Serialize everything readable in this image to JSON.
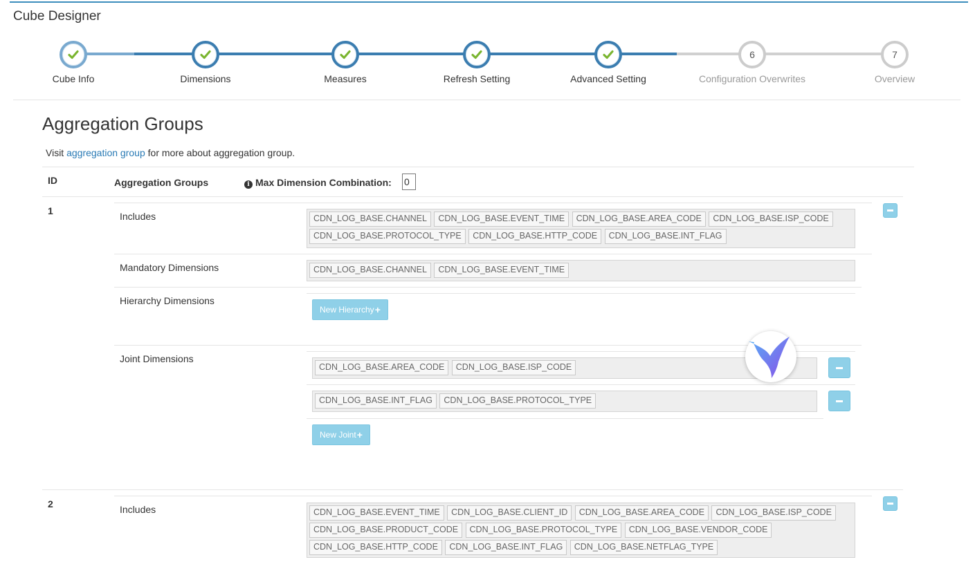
{
  "app": {
    "title": "Cube Designer"
  },
  "steps": [
    {
      "label": "Cube Info",
      "state": "done"
    },
    {
      "label": "Dimensions",
      "state": "done"
    },
    {
      "label": "Measures",
      "state": "done"
    },
    {
      "label": "Refresh Setting",
      "state": "done"
    },
    {
      "label": "Advanced Setting",
      "state": "done"
    },
    {
      "label": "Configuration Overwrites",
      "state": "todo",
      "number": "6"
    },
    {
      "label": "Overview",
      "state": "todo",
      "number": "7"
    }
  ],
  "section": {
    "heading": "Aggregation Groups",
    "visit_prefix": "Visit",
    "visit_link": "aggregation group",
    "visit_suffix": "for more about aggregation group."
  },
  "table": {
    "col_id": "ID",
    "col_groups": "Aggregation Groups",
    "max_combo_label": "Max Dimension Combination:",
    "max_combo_value": "0"
  },
  "groups": [
    {
      "id": "1",
      "includes_label": "Includes",
      "includes": [
        "CDN_LOG_BASE.CHANNEL",
        "CDN_LOG_BASE.EVENT_TIME",
        "CDN_LOG_BASE.AREA_CODE",
        "CDN_LOG_BASE.ISP_CODE",
        "CDN_LOG_BASE.PROTOCOL_TYPE",
        "CDN_LOG_BASE.HTTP_CODE",
        "CDN_LOG_BASE.INT_FLAG"
      ],
      "mandatory_label": "Mandatory Dimensions",
      "mandatory": [
        "CDN_LOG_BASE.CHANNEL",
        "CDN_LOG_BASE.EVENT_TIME"
      ],
      "hierarchy_label": "Hierarchy Dimensions",
      "new_hierarchy_label": "New Hierarchy",
      "joint_label": "Joint Dimensions",
      "joints": [
        [
          "CDN_LOG_BASE.AREA_CODE",
          "CDN_LOG_BASE.ISP_CODE"
        ],
        [
          "CDN_LOG_BASE.INT_FLAG",
          "CDN_LOG_BASE.PROTOCOL_TYPE"
        ]
      ],
      "new_joint_label": "New Joint"
    },
    {
      "id": "2",
      "includes_label": "Includes",
      "includes": [
        "CDN_LOG_BASE.EVENT_TIME",
        "CDN_LOG_BASE.CLIENT_ID",
        "CDN_LOG_BASE.AREA_CODE",
        "CDN_LOG_BASE.ISP_CODE",
        "CDN_LOG_BASE.PRODUCT_CODE",
        "CDN_LOG_BASE.PROTOCOL_TYPE",
        "CDN_LOG_BASE.VENDOR_CODE",
        "CDN_LOG_BASE.HTTP_CODE",
        "CDN_LOG_BASE.INT_FLAG",
        "CDN_LOG_BASE.NETFLAG_TYPE"
      ]
    }
  ],
  "icons": {
    "check": "check-icon",
    "info": "info-icon",
    "minus": "minus-icon",
    "plus": "plus-icon",
    "overlay": "hummingbird-logo"
  },
  "colors": {
    "accent": "#3b7db0",
    "done_check": "#7ab52f",
    "button": "#8fd0e8",
    "link": "#2a7bb5"
  }
}
